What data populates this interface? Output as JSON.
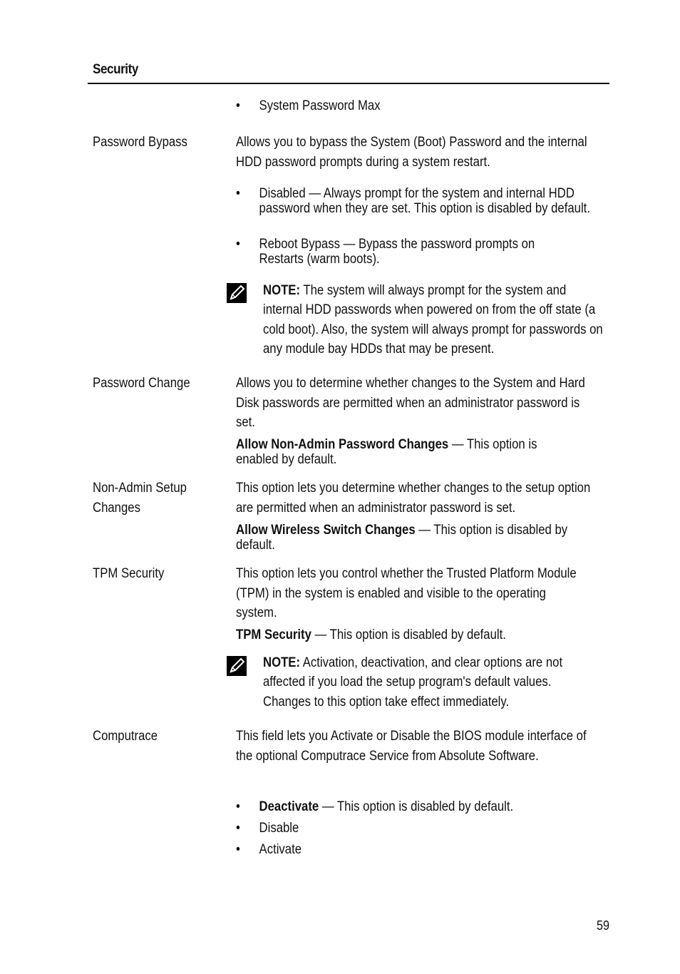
{
  "header": {
    "section_title": "Security"
  },
  "rows": [
    {
      "bullets": [
        "System Password Max"
      ]
    },
    {
      "label": "Password Bypass",
      "description": "Allows you to bypass the System (Boot) Password and the internal HDD password prompts during a system restart.",
      "bullets": [
        "Disabled — Always prompt for the system and internal HDD password when they are set. This option is disabled by default.",
        "Reboot Bypass — Bypass the password prompts on Restarts (warm boots)."
      ],
      "note": {
        "prefix": "NOTE:",
        "text": " The system will always prompt for the system and internal HDD passwords when powered on from the off state (a cold boot). Also, the system will always prompt for passwords on any module bay HDDs that may be present."
      }
    },
    {
      "label": "Password Change",
      "description": "Allows you to determine whether changes to the System and Hard Disk passwords are permitted when an administrator password is set.",
      "option": {
        "name": "Allow Non-Admin Password Changes",
        "text": " — This option is enabled by default."
      }
    },
    {
      "label": "Non-Admin Setup Changes",
      "description": "This option lets you determine whether changes to the setup option are permitted when an administrator password is set.",
      "option": {
        "name": "Allow Wireless Switch Changes",
        "text": " — This option is disabled by default."
      }
    },
    {
      "label": "TPM Security",
      "description": "This option lets you control whether the Trusted Platform Module (TPM) in the system is enabled and visible to the operating system.",
      "option": {
        "name": "TPM Security",
        "text": " — This option is disabled by default."
      },
      "note": {
        "prefix": "NOTE:",
        "text": " Activation, deactivation, and clear options are not affected if you load the setup program's default values. Changes to this option take effect immediately."
      }
    },
    {
      "label": "Computrace",
      "description": "This field lets you Activate or Disable the BIOS module interface of the optional Computrace Service from Absolute Software.",
      "bullets": [
        {
          "name": "Deactivate",
          "text": " — This option is disabled by default."
        },
        "Disable",
        "Activate"
      ]
    }
  ],
  "bullet_glyph": "•",
  "icons": {
    "note": "pencil-note-icon"
  },
  "footer": {
    "page_number": "59"
  }
}
